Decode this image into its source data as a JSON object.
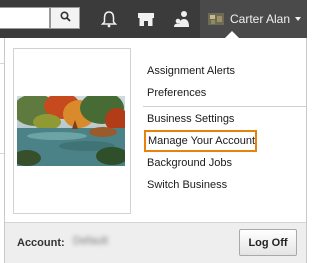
{
  "header": {
    "search": {
      "placeholder": "",
      "value": ""
    },
    "icons": [
      "search-icon",
      "bell-icon",
      "store-icon",
      "people-icon"
    ],
    "user": {
      "name": "Carter Alan",
      "avatar_icon": "business-avatar-icon"
    }
  },
  "menu": {
    "items": [
      {
        "label": "Assignment Alerts"
      },
      {
        "label": "Preferences"
      },
      {
        "label": "Business Settings"
      },
      {
        "label": "Manage Your Account"
      },
      {
        "label": "Background Jobs"
      },
      {
        "label": "Switch Business"
      }
    ],
    "highlighted_index": 3
  },
  "footer": {
    "account_label": "Account:",
    "account_value": "Default",
    "logoff_label": "Log Off"
  },
  "colors": {
    "topbar": "#3b3b3b",
    "highlight_border": "#e8820c",
    "footer_bg": "#eeeeee"
  }
}
